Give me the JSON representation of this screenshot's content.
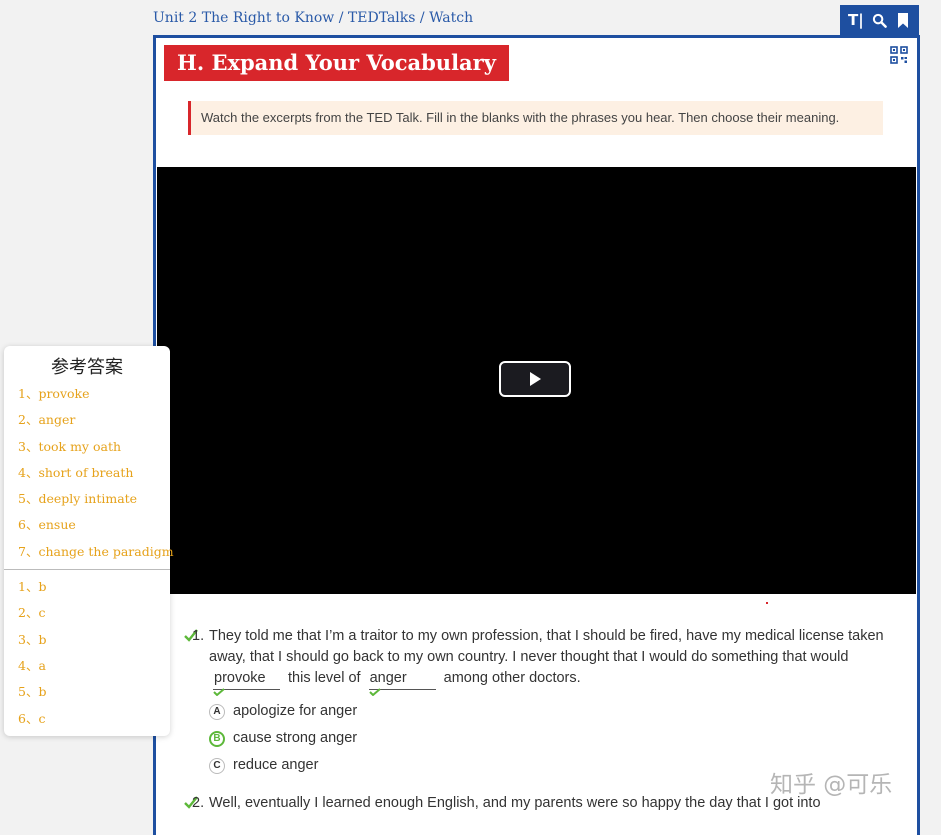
{
  "breadcrumb": {
    "unit": "Unit 2 The Right to Know",
    "sep1": " / ",
    "section": "TEDTalks",
    "sep2": " / ",
    "page": "Watch"
  },
  "toolbar": {
    "font_label": "T|",
    "search_icon": "search-icon",
    "bookmark_icon": "bookmark-icon"
  },
  "title": "H. Expand Your Vocabulary",
  "instruction": "Watch the excerpts from the TED Talk. Fill in the blanks with the phrases you hear. Then choose their meaning.",
  "questions": [
    {
      "num": "1.",
      "text_before": "They told me that I’m a traitor to my own profession, that I should be fired, have my medical license taken away, that I should go back to my own country. I never thought that I would do something that would",
      "blank1": "provoke",
      "text_mid": "this level of",
      "blank2": "anger",
      "text_after": "among other doctors.",
      "options": [
        {
          "letter": "A",
          "text": "apologize for anger"
        },
        {
          "letter": "B",
          "text": "cause strong anger"
        },
        {
          "letter": "C",
          "text": "reduce anger"
        }
      ],
      "selected": "B"
    },
    {
      "num": "2.",
      "text": "Well, eventually I learned enough English, and my parents were so happy the day that I got into"
    }
  ],
  "answer_panel": {
    "title": "参考答案",
    "blanks": [
      "1、provoke",
      "2、anger",
      "3、took my oath",
      "4、short of breath",
      "5、deeply intimate",
      "6、ensue",
      "7、change the paradigm"
    ],
    "choices": [
      "1、b",
      "2、c",
      "3、b",
      "4、a",
      "5、b",
      "6、c"
    ]
  },
  "watermark": "知乎 @可乐",
  "colors": {
    "accent_blue": "#1e4fa0",
    "title_red": "#d8262b",
    "answer_orange": "#e6a21b",
    "correct_green": "#5db83a"
  }
}
